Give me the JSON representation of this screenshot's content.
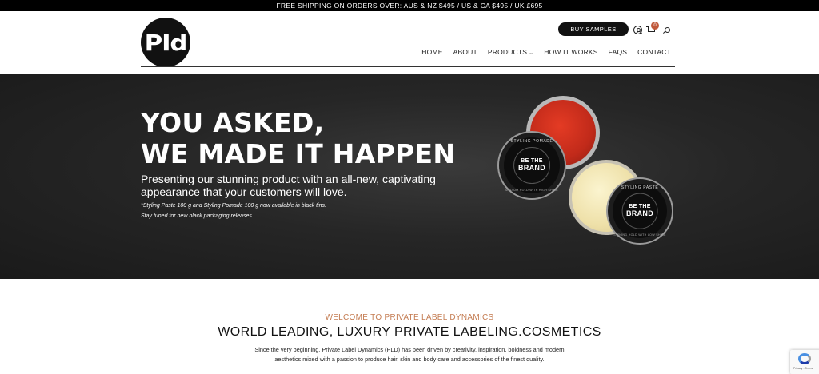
{
  "topbar": {
    "text": "FREE SHIPPING ON ORDERS OVER: AUS & NZ $495 / US & CA $495 / UK £695"
  },
  "header": {
    "logo_text": "PId",
    "buy_samples_label": "BUY SAMPLES",
    "cart_count": "0",
    "icons": {
      "account": "user-icon",
      "cart": "cart-icon",
      "search": "search-icon"
    }
  },
  "nav": {
    "items": [
      {
        "label": "HOME"
      },
      {
        "label": "ABOUT"
      },
      {
        "label": "PRODUCTS",
        "has_dropdown": true
      },
      {
        "label": "HOW IT WORKS"
      },
      {
        "label": "FAQS"
      },
      {
        "label": "CONTACT"
      }
    ]
  },
  "hero": {
    "headline_1": "YOU ASKED,",
    "headline_2": "WE MADE IT HAPPEN",
    "subhead_1": "Presenting our stunning product with an all-new, captivating",
    "subhead_2": "appearance that your customers will love.",
    "note_1": "*Styling Paste 100 g and Styling Pomade 100 g now available in black tins.",
    "note_2": "Stay tuned for new black packaging releases.",
    "tin_a": {
      "top": "STYLING POMADE",
      "brand_1": "BE THE",
      "brand_2": "BRAND",
      "bottom": "MEDIUM HOLD WITH HIGH SHINE"
    },
    "tin_b": {
      "top": "STYLING PASTE",
      "brand_1": "BE THE",
      "brand_2": "BRAND",
      "bottom": "STRONG HOLD WITH LOW SHINE"
    }
  },
  "intro": {
    "kicker": "WELCOME TO PRIVATE LABEL DYNAMICS",
    "title": "WORLD LEADING, LUXURY PRIVATE LABELING.COSMETICS",
    "body_1": "Since the very beginning, Private Label Dynamics (PLD) has been driven by creativity, inspiration, boldness and modern",
    "body_2": "aesthetics mixed with a passion to produce hair, skin and body care and accessories of the finest quality."
  },
  "recaptcha": {
    "text": "Privacy - Terms"
  },
  "colors": {
    "accent": "#c47c52",
    "badge": "#c0583a",
    "hero_bg": "#262626"
  }
}
